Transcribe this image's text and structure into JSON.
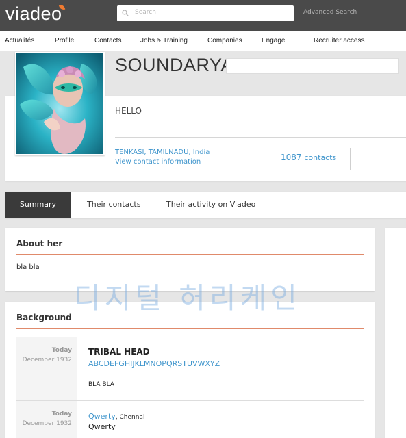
{
  "header": {
    "logo": "viadeo",
    "search_placeholder": "Search",
    "advanced_search": "Advanced Search"
  },
  "nav": {
    "items": [
      "Actualités",
      "Profile",
      "Contacts",
      "Jobs & Training",
      "Companies",
      "Engage",
      "Recruiter access"
    ]
  },
  "profile": {
    "name": "SOUNDARYA",
    "headline": "HELLO",
    "location": "TENKASI, TAMILNADU, India",
    "contact_info_link": "View contact information",
    "contacts_count": "1087",
    "contacts_label": "contacts"
  },
  "tabs": [
    "Summary",
    "Their contacts",
    "Their activity on Viadeo"
  ],
  "about": {
    "title": "About her",
    "text": "bla bla"
  },
  "watermark": "디지털 허리케인",
  "background": {
    "title": "Background",
    "entries": [
      {
        "date_label": "Today",
        "date_since": "December 1932",
        "title": "TRIBAL HEAD",
        "link": "ABCDEFGHIJKLMNOPQRSTUVWXYZ",
        "description": "BLA BLA"
      },
      {
        "date_label": "Today",
        "date_since": "December 1932",
        "company": "Qwerty",
        "city": ", Chennai",
        "role": "Qwerty"
      }
    ]
  },
  "colors": {
    "link": "#3f95cc",
    "accent_rule": "#e08a6b",
    "topbar": "#4a4a4a",
    "active_tab": "#3a3a3a"
  }
}
